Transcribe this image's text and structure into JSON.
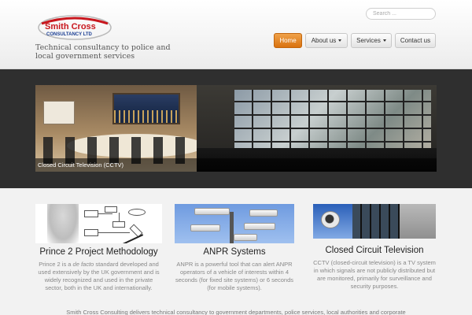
{
  "header": {
    "logo_line1": "Smith Cross",
    "logo_line2": "CONSULTANCY LTD",
    "tagline": "Technical consultancy to police and local government services",
    "search_placeholder": "Search ..."
  },
  "nav": [
    {
      "label": "Home",
      "active": true,
      "has_dropdown": false
    },
    {
      "label": "About us",
      "active": false,
      "has_dropdown": true
    },
    {
      "label": "Services",
      "active": false,
      "has_dropdown": true
    },
    {
      "label": "Contact us",
      "active": false,
      "has_dropdown": false
    }
  ],
  "banner": {
    "caption": "Closed Circuit Television (CCTV)"
  },
  "features": [
    {
      "title": "Prince 2 Project Methodology",
      "text_before": "Prince 2 is a ",
      "text_em": "de facto",
      "text_after": " standard developed and used extensively by the UK government and is widely recognized and used in the private sector, both in the UK and internationally."
    },
    {
      "title": "ANPR Systems",
      "text": "ANPR is a powerful tool that can alert ANPR operators of a vehicle of interests within 4 seconds (for fixed site systems) or 6 seconds (for mobile systems)."
    },
    {
      "title": "Closed Circuit Television",
      "text": "CCTV (closed-circuit television) is a TV system in which signals are not publicly distributed but are monitored, primarily for surveillance and security purposes."
    }
  ],
  "intro": "Smith Cross Consulting delivers technical consultancy to government departments, police services, local authorities and corporate",
  "colors": {
    "accent": "#e07d1c",
    "logo_red": "#c8161d",
    "logo_blue": "#1b3f94",
    "banner_bg": "#2f2f2f"
  }
}
